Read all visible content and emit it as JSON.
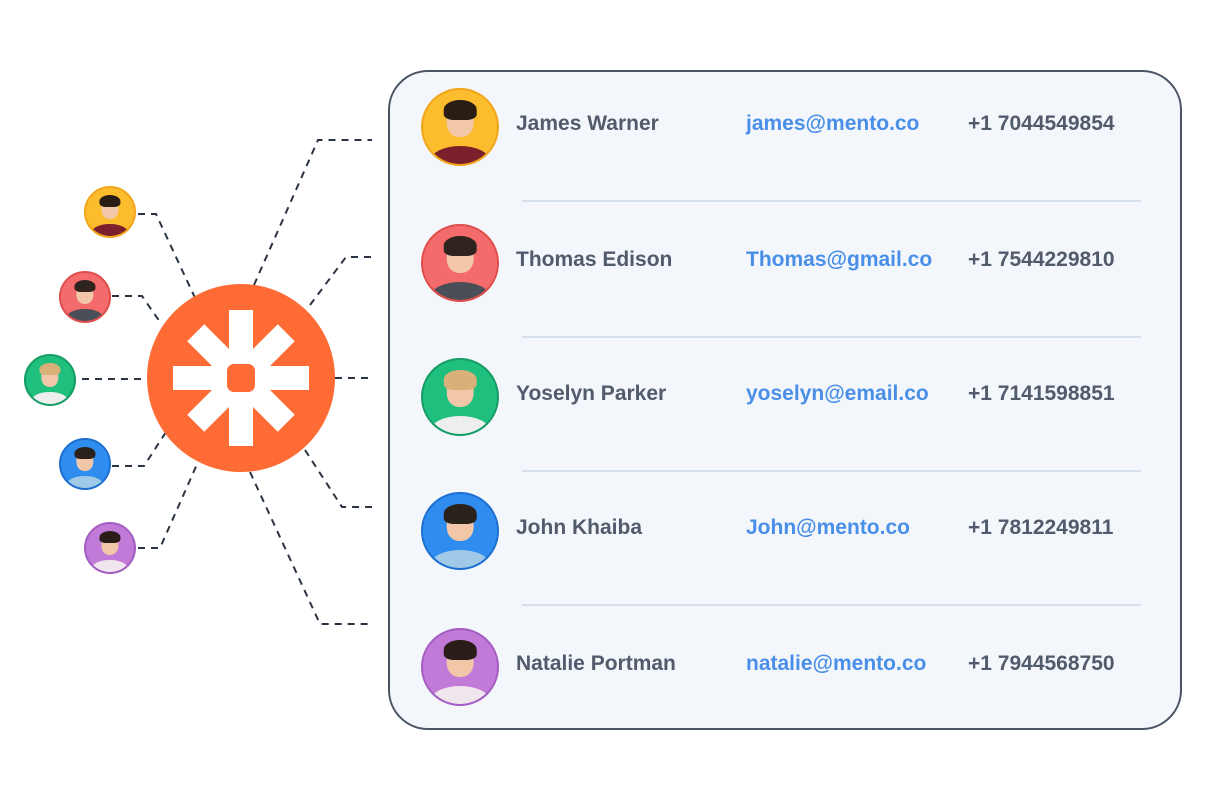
{
  "colors": {
    "hub": "#ff6b35",
    "hub_glyph": "#ffffff",
    "connector": "#2b3444",
    "card_bg": "#f3f7fc",
    "card_border": "#4a5464",
    "divider": "#d5dfe9",
    "name_text": "#515b6b",
    "email_text": "#4a8fe7",
    "phone_text": "#515b6b"
  },
  "hub": {
    "icon": "asterisk-logo-icon"
  },
  "sources": [
    {
      "icon": "person-avatar-icon",
      "bg": "#fbbd2d",
      "border": "#f2a51a",
      "hair": "#2a1d16",
      "shirt": "#7a1f2b"
    },
    {
      "icon": "person-avatar-icon",
      "bg": "#f46b6b",
      "border": "#e04d4d",
      "hair": "#2f241d",
      "shirt": "#4a4e57"
    },
    {
      "icon": "person-avatar-icon",
      "bg": "#1fbf7e",
      "border": "#179c66",
      "hair": "#d9b07a",
      "shirt": "#eeeeee"
    },
    {
      "icon": "person-avatar-icon",
      "bg": "#2f8df0",
      "border": "#1c6fd0",
      "hair": "#2b211b",
      "shirt": "#9fc9e6"
    },
    {
      "icon": "person-avatar-icon",
      "bg": "#c27ad9",
      "border": "#a45cc0",
      "hair": "#2a1c18",
      "shirt": "#f0e6ee"
    }
  ],
  "contacts": [
    {
      "name": "James Warner",
      "email": "james@mento.co",
      "phone": "+1 7044549854",
      "avatar": {
        "bg": "#fbbd2d",
        "border": "#f2a51a",
        "hair": "#2a1d16",
        "shirt": "#7a1f2b"
      }
    },
    {
      "name": "Thomas Edison",
      "email": "Thomas@gmail.co",
      "phone": "+1 7544229810",
      "avatar": {
        "bg": "#f46b6b",
        "border": "#e04d4d",
        "hair": "#2f241d",
        "shirt": "#4a4e57"
      }
    },
    {
      "name": "Yoselyn Parker",
      "email": "yoselyn@email.co",
      "phone": "+1 7141598851",
      "avatar": {
        "bg": "#1fbf7e",
        "border": "#179c66",
        "hair": "#d9b07a",
        "shirt": "#eeeeee"
      }
    },
    {
      "name": "John Khaiba",
      "email": "John@mento.co",
      "phone": "+1 7812249811",
      "avatar": {
        "bg": "#2f8df0",
        "border": "#1c6fd0",
        "hair": "#2b211b",
        "shirt": "#9fc9e6"
      }
    },
    {
      "name": "Natalie Portman",
      "email": "natalie@mento.co",
      "phone": "+1 7944568750",
      "avatar": {
        "bg": "#c27ad9",
        "border": "#a45cc0",
        "hair": "#2a1c18",
        "shirt": "#f0e6ee"
      }
    }
  ]
}
